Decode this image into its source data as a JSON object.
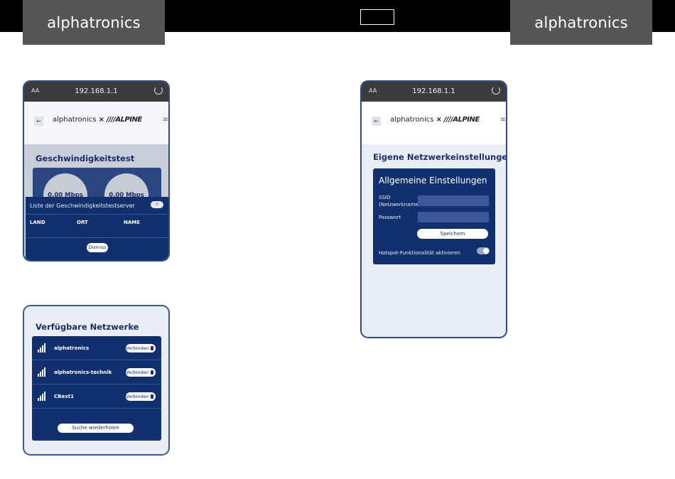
{
  "brand": {
    "name": "alphatronics"
  },
  "browser": {
    "aa": "AA",
    "url": "192.168.1.1"
  },
  "site": {
    "logo_main": "alphatronics",
    "logo_x": "×",
    "logo_partner": "////ALPINE",
    "back": "←",
    "menu": "≡"
  },
  "speedtest": {
    "title": "Geschwindigkeitstest",
    "download": "0.00 Mbps",
    "upload": "0.00 Mbps",
    "modal": {
      "title": "Liste der Geschwindigkeitstestserver",
      "close": "×",
      "columns": [
        "LAND",
        "ORT",
        "NAME"
      ],
      "dismiss": "Dismiss"
    }
  },
  "networks": {
    "title": "Verfügbare Netzwerke",
    "items": [
      {
        "name": "alphatronics",
        "action": "Verbinden"
      },
      {
        "name": "alphatronics-technik",
        "action": "Verbinden"
      },
      {
        "name": "CBext1",
        "action": "Verbinden"
      }
    ],
    "retry": "Suche wiederholen"
  },
  "settings": {
    "title": "Eigene Netzwerkeinstellungen",
    "card_title": "Allgemeine Einstellungen",
    "ssid_label_1": "SSID",
    "ssid_label_2": "(Netzwerkname)",
    "password_label": "Passwort",
    "save": "Speichern",
    "hotspot_label": "Hotspot-Funktionalität aktivieren",
    "hotspot_enabled": true
  },
  "colors": {
    "navy": "#13306e",
    "title": "#1d2e63",
    "brand_tab": "#555556",
    "frame": "#2c4a86"
  }
}
